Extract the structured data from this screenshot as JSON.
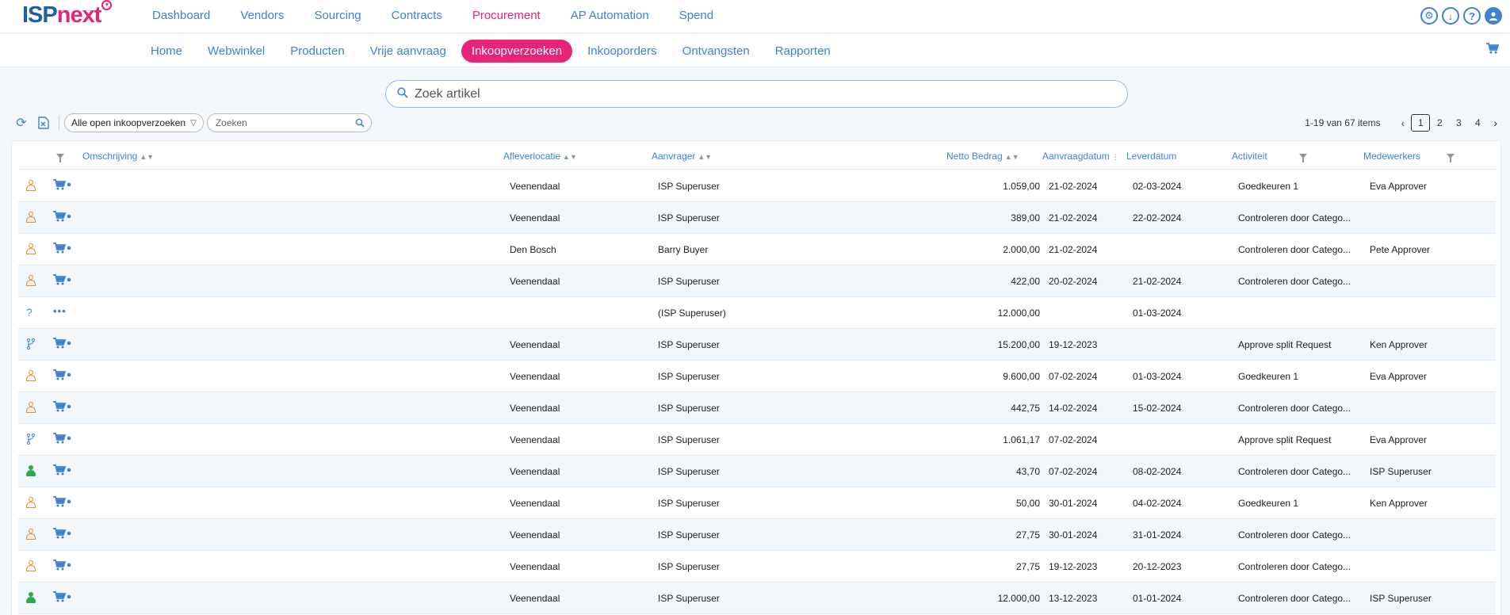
{
  "brand": {
    "part1": "ISP",
    "part2": "next"
  },
  "topnav": [
    {
      "label": "Dashboard",
      "active": false
    },
    {
      "label": "Vendors",
      "active": false
    },
    {
      "label": "Sourcing",
      "active": false
    },
    {
      "label": "Contracts",
      "active": false
    },
    {
      "label": "Procurement",
      "active": true
    },
    {
      "label": "AP Automation",
      "active": false
    },
    {
      "label": "Spend",
      "active": false
    }
  ],
  "topicons": [
    "settings-icon",
    "download-icon",
    "help-icon",
    "user-icon"
  ],
  "subnav": [
    {
      "label": "Home",
      "active": false
    },
    {
      "label": "Webwinkel",
      "active": false
    },
    {
      "label": "Producten",
      "active": false
    },
    {
      "label": "Vrije aanvraag",
      "active": false
    },
    {
      "label": "Inkoopverzoeken",
      "active": true
    },
    {
      "label": "Inkooporders",
      "active": false
    },
    {
      "label": "Ontvangsten",
      "active": false
    },
    {
      "label": "Rapporten",
      "active": false
    }
  ],
  "search": {
    "placeholder": "Zoek artikel"
  },
  "toolbar": {
    "filter_value": "Alle open inkoopverzoeken",
    "search_placeholder": "Zoeken"
  },
  "pager": {
    "info": "1-19 van 67 items",
    "pages": [
      "1",
      "2",
      "3",
      "4"
    ],
    "current": "1"
  },
  "columns": {
    "omschrijving": "Omschrijving",
    "afleverlocatie": "Afleverlocatie",
    "aanvrager": "Aanvrager",
    "netto_bedrag": "Netto Bedrag",
    "aanvraagdatum": "Aanvraagdatum",
    "leverdatum": "Leverdatum",
    "activiteit": "Activiteit",
    "medewerkers": "Medewerkers"
  },
  "rows": [
    {
      "status": "person-orange",
      "type": "cart",
      "loc": "Veenendaal",
      "req": "ISP Superuser",
      "amt": "1.059,00",
      "date": "21-02-2024",
      "lev": "02-03-2024",
      "act": "Goedkeuren 1",
      "med": "Eva Approver"
    },
    {
      "status": "person-orange",
      "type": "cart",
      "loc": "Veenendaal",
      "req": "ISP Superuser",
      "amt": "389,00",
      "date": "21-02-2024",
      "lev": "22-02-2024",
      "act": "Controleren door Catego...",
      "med": ""
    },
    {
      "status": "person-orange",
      "type": "cart",
      "loc": "Den Bosch",
      "req": "Barry Buyer",
      "amt": "2.000,00",
      "date": "21-02-2024",
      "lev": "",
      "act": "Controleren door Catego...",
      "med": "Pete Approver"
    },
    {
      "status": "person-orange",
      "type": "cart",
      "loc": "Veenendaal",
      "req": "ISP Superuser",
      "amt": "422,00",
      "date": "20-02-2024",
      "lev": "21-02-2024",
      "act": "Controleren door Catego...",
      "med": ""
    },
    {
      "status": "question",
      "type": "dots",
      "loc": "",
      "req": "(ISP Superuser)",
      "amt": "12.000,00",
      "date": "",
      "lev": "01-03-2024",
      "act": "",
      "med": ""
    },
    {
      "status": "branch",
      "type": "cart",
      "loc": "Veenendaal",
      "req": "ISP Superuser",
      "amt": "15.200,00",
      "date": "19-12-2023",
      "lev": "",
      "act": "Approve split Request",
      "med": "Ken Approver"
    },
    {
      "status": "person-orange",
      "type": "cart",
      "loc": "Veenendaal",
      "req": "ISP Superuser",
      "amt": "9.600,00",
      "date": "07-02-2024",
      "lev": "01-03-2024",
      "act": "Goedkeuren 1",
      "med": "Eva Approver"
    },
    {
      "status": "person-orange",
      "type": "cart",
      "loc": "Veenendaal",
      "req": "ISP Superuser",
      "amt": "442,75",
      "date": "14-02-2024",
      "lev": "15-02-2024",
      "act": "Controleren door Catego...",
      "med": ""
    },
    {
      "status": "branch",
      "type": "cart",
      "loc": "Veenendaal",
      "req": "ISP Superuser",
      "amt": "1.061,17",
      "date": "07-02-2024",
      "lev": "",
      "act": "Approve split Request",
      "med": "Eva Approver"
    },
    {
      "status": "person-green",
      "type": "cart",
      "loc": "Veenendaal",
      "req": "ISP Superuser",
      "amt": "43,70",
      "date": "07-02-2024",
      "lev": "08-02-2024",
      "act": "Controleren door Catego...",
      "med": "ISP Superuser"
    },
    {
      "status": "person-orange",
      "type": "cart",
      "loc": "Veenendaal",
      "req": "ISP Superuser",
      "amt": "50,00",
      "date": "30-01-2024",
      "lev": "04-02-2024",
      "act": "Goedkeuren 1",
      "med": "Ken Approver"
    },
    {
      "status": "person-orange",
      "type": "cart",
      "loc": "Veenendaal",
      "req": "ISP Superuser",
      "amt": "27,75",
      "date": "30-01-2024",
      "lev": "31-01-2024",
      "act": "Controleren door Catego...",
      "med": ""
    },
    {
      "status": "person-orange",
      "type": "cart",
      "loc": "Veenendaal",
      "req": "ISP Superuser",
      "amt": "27,75",
      "date": "19-12-2023",
      "lev": "20-12-2023",
      "act": "Controleren door Catego...",
      "med": ""
    },
    {
      "status": "person-green",
      "type": "cart",
      "loc": "Veenendaal",
      "req": "ISP Superuser",
      "amt": "12.000,00",
      "date": "13-12-2023",
      "lev": "01-01-2024",
      "act": "Controleren door Catego...",
      "med": "ISP Superuser"
    }
  ],
  "colors": {
    "primary": "#3f82cf",
    "accent": "#e8247a",
    "pending": "#f08a24",
    "approved": "#2ea84a"
  }
}
